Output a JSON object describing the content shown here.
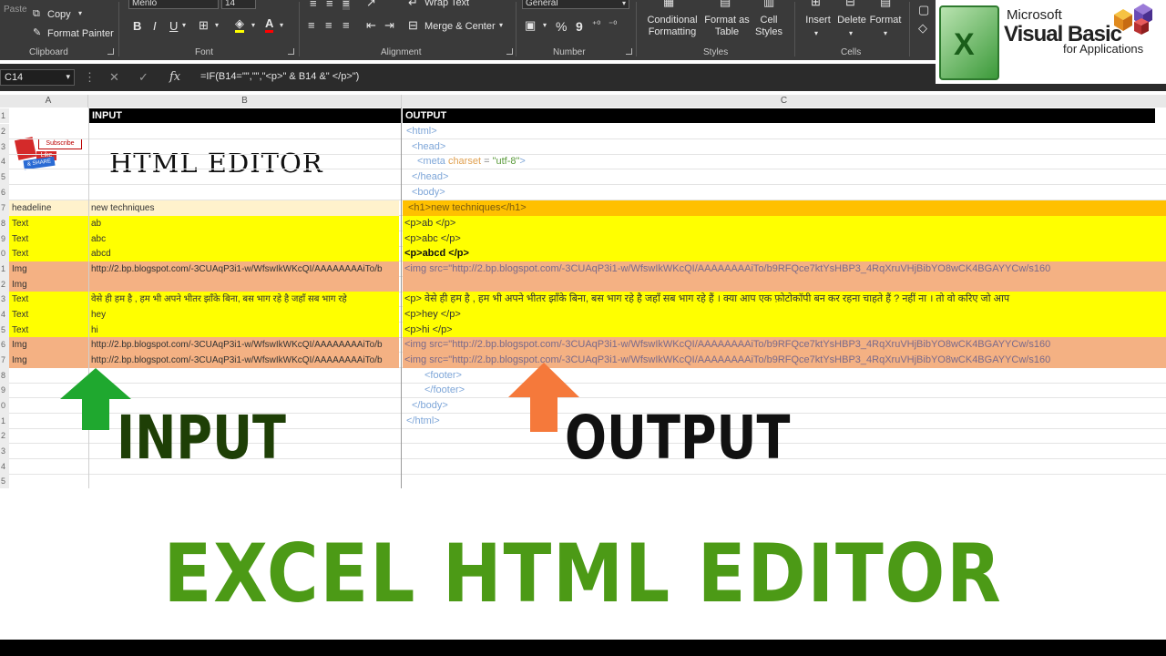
{
  "ribbon": {
    "clipboard": {
      "paste": "Paste",
      "copy": "Copy",
      "format_painter": "Format Painter",
      "label": "Clipboard"
    },
    "font": {
      "name": "Menlo",
      "size": "14",
      "bold": "B",
      "italic": "I",
      "underline": "U",
      "label": "Font"
    },
    "alignment": {
      "wrap_text": "Wrap Text",
      "merge_center": "Merge & Center",
      "label": "Alignment"
    },
    "number": {
      "format": "General",
      "percent": "%",
      "comma": "9",
      "label": "Number"
    },
    "styles": {
      "conditional": "Conditional\nFormatting",
      "format_table": "Format as\nTable",
      "cell_styles": "Cell\nStyles",
      "label": "Styles"
    },
    "cells": {
      "insert": "Insert",
      "delete": "Delete",
      "format": "Format",
      "label": "Cells"
    }
  },
  "formula_bar": {
    "name_box": "C14",
    "fx": "fx",
    "formula": "=IF(B14=\"\",\"\",\"<p>\" & B14 &\" </p>\")"
  },
  "logo": {
    "microsoft": "Microsoft",
    "visual_basic": "Visual Basic",
    "for_applications": "for Applications",
    "excel_letter": "X"
  },
  "sheet": {
    "col_headers": [
      "A",
      "B",
      "C"
    ],
    "header_row": {
      "b": "INPUT",
      "c": "OUTPUT"
    },
    "editor_title": "HTML EDITOR",
    "subscribe_badge": {
      "subscribe": "Subscribe",
      "like": "Like",
      "share": "& SHARE"
    },
    "rows": [
      {
        "n": "2",
        "a": "",
        "b": "",
        "c": "<html>"
      },
      {
        "n": "3",
        "a": "",
        "b": "",
        "c": "<head>"
      },
      {
        "n": "4",
        "a": "",
        "b": "",
        "c_tag": "<meta ",
        "c_attr": "charset",
        "c_eq": " =",
        "c_val": "\"utf-8\"",
        "c_end": ">"
      },
      {
        "n": "5",
        "a": "",
        "b": "",
        "c": "</head>"
      },
      {
        "n": "6",
        "a": "",
        "b": "",
        "c": "<body>"
      },
      {
        "n": "7",
        "a": "headeline",
        "b": "new techniques",
        "c": "<h1>new techniques</h1>"
      },
      {
        "n": "8",
        "a": "Text",
        "b": "ab",
        "c": "<p>ab </p>"
      },
      {
        "n": "9",
        "a": "Text",
        "b": "abc",
        "c": "<p>abc </p>"
      },
      {
        "n": "0",
        "a": "Text",
        "b": "abcd",
        "c": "<p>abcd </p>"
      },
      {
        "n": "1",
        "a": "Img",
        "b": "http://2.bp.blogspot.com/-3CUAqP3i1-w/WfswIkWKcQI/AAAAAAAAiTo/b",
        "c": "<img src=\"http://2.bp.blogspot.com/-3CUAqP3i1-w/WfswIkWKcQI/AAAAAAAAiTo/b9RFQce7ktYsHBP3_4RqXruVHjBibYO8wCK4BGAYYCw/s160"
      },
      {
        "n": "2",
        "a": "Img",
        "b": "",
        "c": ""
      },
      {
        "n": "3",
        "a": "Text",
        "b": "वेसे ही हम है , हम भी अपने भीतर झाँके बिना, बस भाग रहे है जहाँ सब भाग रहे",
        "c": "<p> वेसे ही हम है , हम भी अपने भीतर झाँके बिना, बस भाग रहे है जहाँ सब भाग रहे हैं । क्या आप एक फ़ोटोकॉपी बन कर रहना चाहते हैं ? नहीं ना । तो वो करिए जो आप"
      },
      {
        "n": "4",
        "a": "Text",
        "b": "hey",
        "c": "<p>hey </p>"
      },
      {
        "n": "5",
        "a": "Text",
        "b": "hi",
        "c": "<p>hi </p>"
      },
      {
        "n": "6",
        "a": "Img",
        "b": "http://2.bp.blogspot.com/-3CUAqP3i1-w/WfswIkWKcQI/AAAAAAAAiTo/b",
        "c": "<img src=\"http://2.bp.blogspot.com/-3CUAqP3i1-w/WfswIkWKcQI/AAAAAAAAiTo/b9RFQce7ktYsHBP3_4RqXruVHjBibYO8wCK4BGAYYCw/s160"
      },
      {
        "n": "7",
        "a": "Img",
        "b": "http://2.bp.blogspot.com/-3CUAqP3i1-w/WfswIkWKcQI/AAAAAAAAiTo/b",
        "c": "<img src=\"http://2.bp.blogspot.com/-3CUAqP3i1-w/WfswIkWKcQI/AAAAAAAAiTo/b9RFQce7ktYsHBP3_4RqXruVHjBibYO8wCK4BGAYYCw/s160"
      },
      {
        "n": "8",
        "a": "",
        "b": "",
        "c": "<footer>"
      },
      {
        "n": "9",
        "a": "",
        "b": "",
        "c": "</footer>"
      },
      {
        "n": "0",
        "a": "",
        "b": "",
        "c": "</body>"
      },
      {
        "n": "1",
        "a": "",
        "b": "",
        "c": "</html>"
      },
      {
        "n": "2",
        "a": "",
        "b": "",
        "c": ""
      },
      {
        "n": "3",
        "a": "",
        "b": "",
        "c": ""
      },
      {
        "n": "4",
        "a": "",
        "b": "",
        "c": ""
      },
      {
        "n": "5",
        "a": "",
        "b": "",
        "c": ""
      }
    ]
  },
  "annotations": {
    "input_word": "INPUT",
    "output_word": "OUTPUT"
  },
  "banner": {
    "title": "EXCEL HTML EDITOR"
  },
  "colors": {
    "yellow_fill": "#ffff00",
    "peach_fill": "#f4b183",
    "orange_fill": "#ffc000",
    "cream_fill": "#fff2cc",
    "green_arrow": "#1fa82f",
    "orange_arrow": "#f5793b",
    "banner_green": "#4c9a16",
    "input_word": "#1e3f06",
    "output_word": "#111111"
  }
}
